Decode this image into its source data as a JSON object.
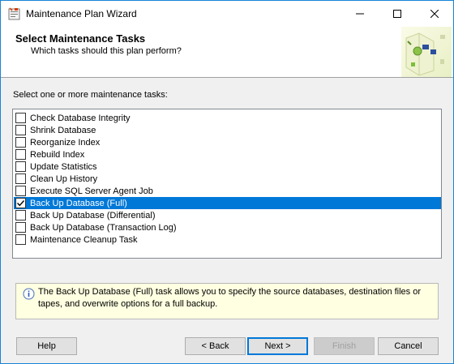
{
  "window": {
    "title": "Maintenance Plan Wizard"
  },
  "header": {
    "title": "Select Maintenance Tasks",
    "subtitle": "Which tasks should this plan perform?"
  },
  "main": {
    "section_label": "Select one or more maintenance tasks:",
    "tasks": [
      {
        "label": "Check Database Integrity",
        "checked": false,
        "selected": false
      },
      {
        "label": "Shrink Database",
        "checked": false,
        "selected": false
      },
      {
        "label": "Reorganize Index",
        "checked": false,
        "selected": false
      },
      {
        "label": "Rebuild Index",
        "checked": false,
        "selected": false
      },
      {
        "label": "Update Statistics",
        "checked": false,
        "selected": false
      },
      {
        "label": "Clean Up History",
        "checked": false,
        "selected": false
      },
      {
        "label": "Execute SQL Server Agent Job",
        "checked": false,
        "selected": false
      },
      {
        "label": "Back Up Database (Full)",
        "checked": true,
        "selected": true
      },
      {
        "label": "Back Up Database (Differential)",
        "checked": false,
        "selected": false
      },
      {
        "label": "Back Up Database (Transaction Log)",
        "checked": false,
        "selected": false
      },
      {
        "label": "Maintenance Cleanup Task",
        "checked": false,
        "selected": false
      }
    ],
    "info_text": "The Back Up Database (Full) task allows you to specify the source databases, destination files or tapes, and overwrite options for a full backup."
  },
  "buttons": {
    "help": "Help",
    "back": "< Back",
    "next": "Next >",
    "finish": "Finish",
    "cancel": "Cancel"
  },
  "colors": {
    "selection": "#0078d7",
    "info_background": "#ffffe1"
  }
}
